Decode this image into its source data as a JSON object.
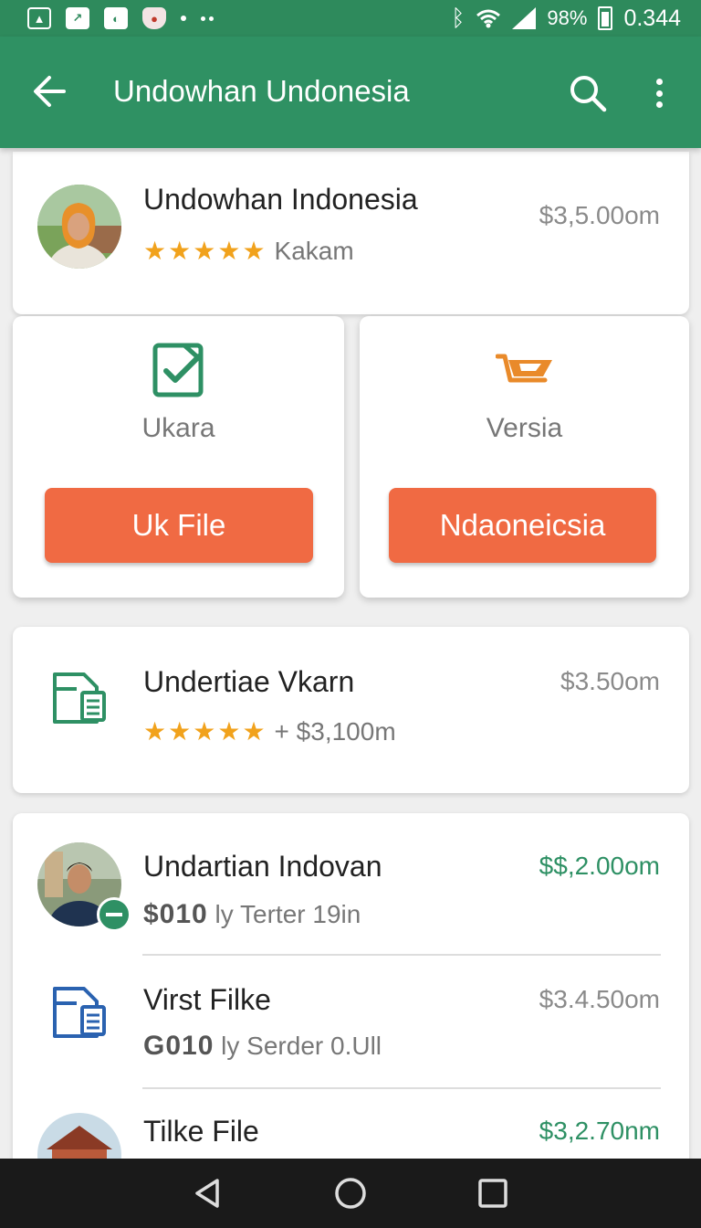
{
  "status_bar": {
    "battery_text": "98%",
    "time": "0.344",
    "icons": [
      "image-icon",
      "chart-icon",
      "whatsapp-icon",
      "shield-icon",
      "dot-icon",
      "more-dots-icon",
      "bluetooth-icon",
      "wifi-icon",
      "signal-icon",
      "battery-icon"
    ]
  },
  "app_bar": {
    "title": "Undowhan Undonesia",
    "back_icon": "arrow-left-icon",
    "search_icon": "search-icon",
    "menu_icon": "more-vert-icon"
  },
  "profile_card": {
    "name": "Undowhan Indonesia",
    "rating_label": "Kakam",
    "stars": 5,
    "price": "$3,5.00om"
  },
  "actions": [
    {
      "icon": "checklist-icon",
      "label": "Ukara",
      "button": "Uk File",
      "icon_color": "#2e9064"
    },
    {
      "icon": "cart-icon",
      "label": "Versia",
      "button": "Ndaoneicsia",
      "icon_color": "#e98a2a"
    }
  ],
  "document_card": {
    "title": "Undertiae Vkarn",
    "stars": 5,
    "extra": "+ $3,100m",
    "price": "$3.50om"
  },
  "list": [
    {
      "title": "Undartian Indovan",
      "sub_bold": "$010",
      "sub": "ly Terter 19in",
      "price": "$$,2.00om",
      "price_color": "#2e9064"
    },
    {
      "title": "Virst Filke",
      "sub_bold": "G010",
      "sub": "ly Serder 0.Ull",
      "price": "$3.4.50om",
      "price_color": "#8a8a8a"
    },
    {
      "title": "Tilke File",
      "sub_bold": "",
      "sub": "",
      "price": "$3,2.70nm",
      "price_color": "#2e9064"
    }
  ],
  "colors": {
    "primary": "#2f9163",
    "accent": "#f06a43",
    "star": "#f1a21c"
  }
}
